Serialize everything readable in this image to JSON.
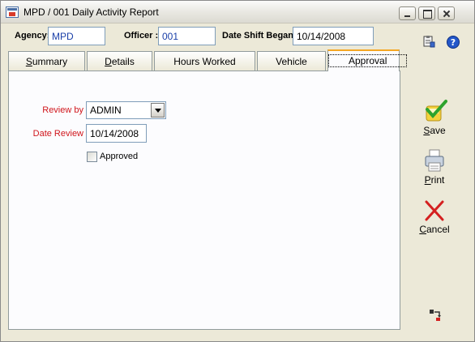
{
  "window": {
    "title": "MPD / 001 Daily Activity Report"
  },
  "header": {
    "agency_label": "Agency:",
    "agency_value": "MPD",
    "officer_label": "Officer :",
    "officer_value": "001",
    "shift_label": "Date Shift Began :",
    "shift_value": "10/14/2008"
  },
  "tabs": [
    {
      "label": "Summary",
      "accel": "S",
      "rest": "ummary",
      "active": false
    },
    {
      "label": "Details",
      "accel": "D",
      "rest": "etails",
      "active": false
    },
    {
      "label": "Hours Worked",
      "active": false
    },
    {
      "label": "Vehicle",
      "active": false
    },
    {
      "label": "Approval",
      "active": true
    }
  ],
  "approval": {
    "review_by_label": "Review by",
    "review_by_value": "ADMIN",
    "date_review_label": "Date Review",
    "date_review_value": "10/14/2008",
    "approved_label": "Approved",
    "approved_checked": false
  },
  "actions": {
    "save_accel": "S",
    "save_rest": "ave",
    "print_accel": "P",
    "print_rest": "rint",
    "cancel_accel": "C",
    "cancel_rest": "ancel"
  },
  "colors": {
    "label_red": "#d0161c",
    "header_value_blue": "#1a3fa8",
    "active_tab_accent": "#f5a623"
  },
  "icons": [
    "app-icon",
    "minimize-icon",
    "maximize-icon",
    "close-icon",
    "clipboard-icon",
    "help-icon",
    "save-check-icon",
    "printer-icon",
    "cancel-x-icon",
    "swap-icon"
  ]
}
